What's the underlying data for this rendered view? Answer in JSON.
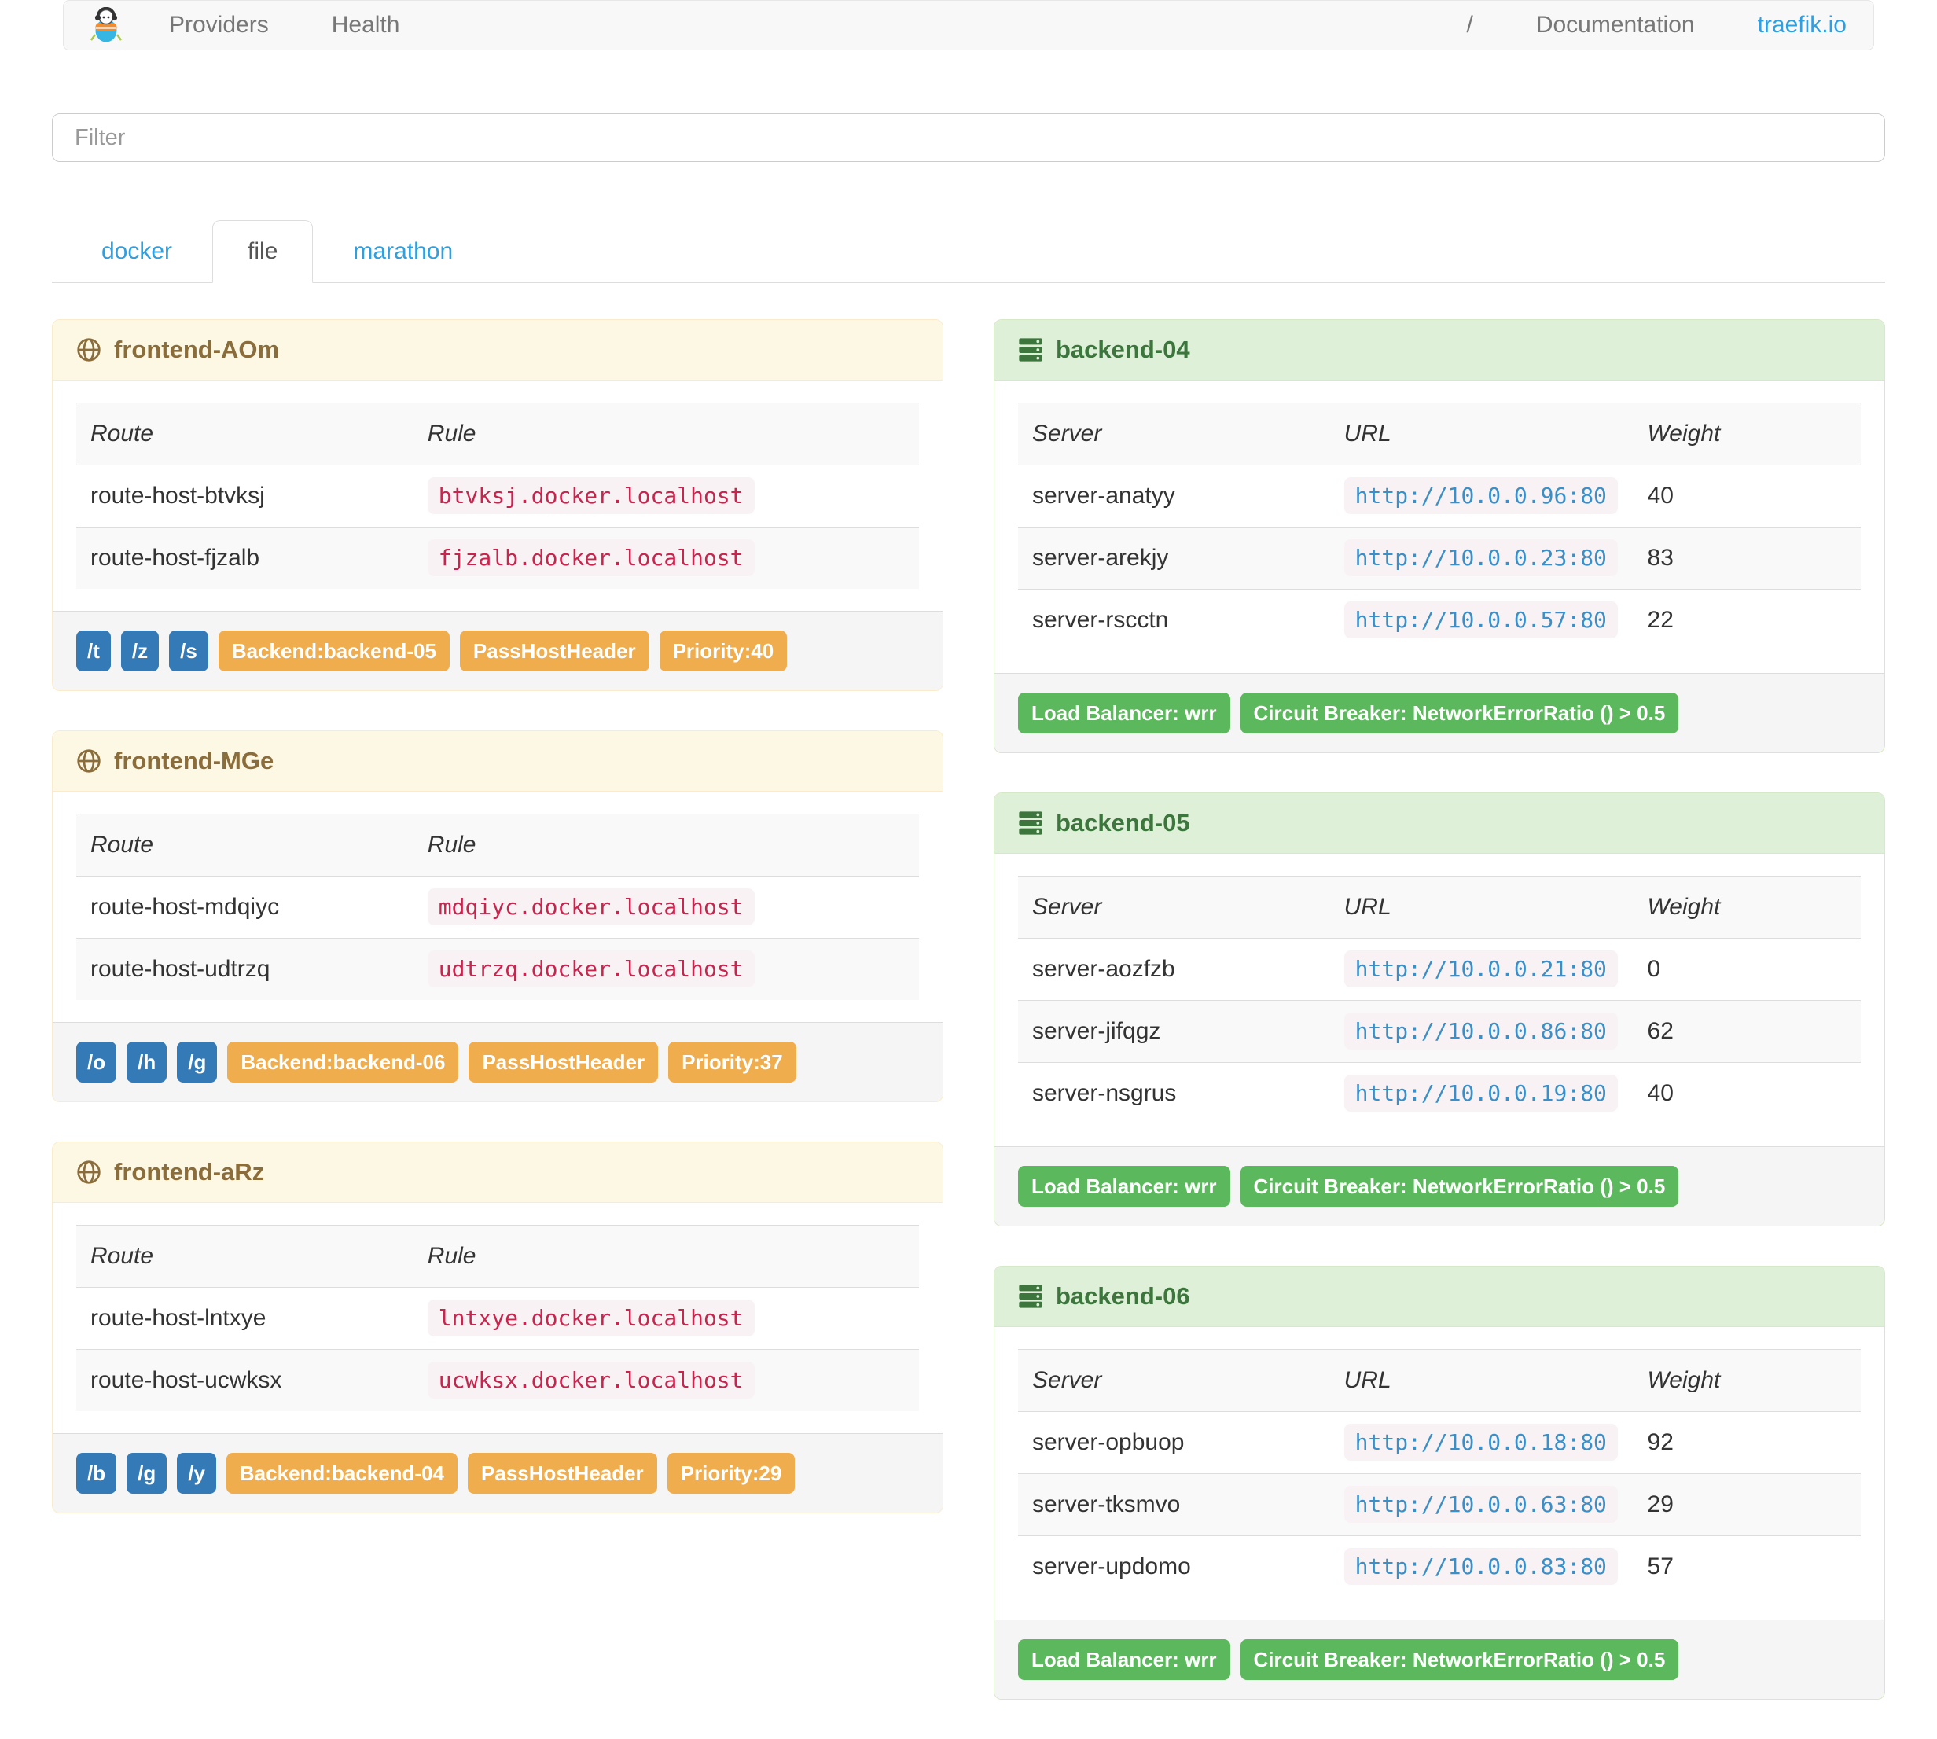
{
  "navbar": {
    "providers_label": "Providers",
    "health_label": "Health",
    "separator": "/",
    "documentation_label": "Documentation",
    "traefik_io_label": "traefik.io",
    "logo_icon": "traefik-mascot"
  },
  "filter": {
    "placeholder": "Filter"
  },
  "tabs": [
    {
      "label": "docker",
      "active": false
    },
    {
      "label": "file",
      "active": true
    },
    {
      "label": "marathon",
      "active": false
    }
  ],
  "frontend_columns": [
    "Route",
    "Rule"
  ],
  "backend_columns": [
    "Server",
    "URL",
    "Weight"
  ],
  "frontends": [
    {
      "title": "frontend-AOm",
      "rows": [
        {
          "route": "route-host-btvksj",
          "rule": "btvksj.docker.localhost"
        },
        {
          "route": "route-host-fjzalb",
          "rule": "fjzalb.docker.localhost"
        }
      ],
      "tags": [
        "/t",
        "/z",
        "/s"
      ],
      "labels": [
        "Backend:backend-05",
        "PassHostHeader",
        "Priority:40"
      ]
    },
    {
      "title": "frontend-MGe",
      "rows": [
        {
          "route": "route-host-mdqiyc",
          "rule": "mdqiyc.docker.localhost"
        },
        {
          "route": "route-host-udtrzq",
          "rule": "udtrzq.docker.localhost"
        }
      ],
      "tags": [
        "/o",
        "/h",
        "/g"
      ],
      "labels": [
        "Backend:backend-06",
        "PassHostHeader",
        "Priority:37"
      ]
    },
    {
      "title": "frontend-aRz",
      "rows": [
        {
          "route": "route-host-lntxye",
          "rule": "lntxye.docker.localhost"
        },
        {
          "route": "route-host-ucwksx",
          "rule": "ucwksx.docker.localhost"
        }
      ],
      "tags": [
        "/b",
        "/g",
        "/y"
      ],
      "labels": [
        "Backend:backend-04",
        "PassHostHeader",
        "Priority:29"
      ]
    }
  ],
  "backends": [
    {
      "title": "backend-04",
      "rows": [
        {
          "server": "server-anatyy",
          "url": "http://10.0.0.96:80",
          "weight": "40"
        },
        {
          "server": "server-arekjy",
          "url": "http://10.0.0.23:80",
          "weight": "83"
        },
        {
          "server": "server-rscctn",
          "url": "http://10.0.0.57:80",
          "weight": "22"
        }
      ],
      "labels": [
        "Load Balancer: wrr",
        "Circuit Breaker: NetworkErrorRatio () > 0.5"
      ]
    },
    {
      "title": "backend-05",
      "rows": [
        {
          "server": "server-aozfzb",
          "url": "http://10.0.0.21:80",
          "weight": "0"
        },
        {
          "server": "server-jifqgz",
          "url": "http://10.0.0.86:80",
          "weight": "62"
        },
        {
          "server": "server-nsgrus",
          "url": "http://10.0.0.19:80",
          "weight": "40"
        }
      ],
      "labels": [
        "Load Balancer: wrr",
        "Circuit Breaker: NetworkErrorRatio () > 0.5"
      ]
    },
    {
      "title": "backend-06",
      "rows": [
        {
          "server": "server-opbuop",
          "url": "http://10.0.0.18:80",
          "weight": "92"
        },
        {
          "server": "server-tksmvo",
          "url": "http://10.0.0.63:80",
          "weight": "29"
        },
        {
          "server": "server-updomo",
          "url": "http://10.0.0.83:80",
          "weight": "57"
        }
      ],
      "labels": [
        "Load Balancer: wrr",
        "Circuit Breaker: NetworkErrorRatio () > 0.5"
      ]
    }
  ],
  "colors": {
    "link_blue": "#2f9fe0",
    "badge_blue": "#337ab7",
    "badge_orange": "#f0ad4e",
    "badge_green": "#5cb85c",
    "code_crimson": "#c7254e",
    "code_background": "#f9f2f4",
    "url_blue": "#3b8fc8",
    "frontend_header_background": "#fcf8e3",
    "frontend_header_text": "#8a6d3b",
    "backend_header_background": "#dff0d8",
    "backend_header_text": "#3c763d"
  }
}
